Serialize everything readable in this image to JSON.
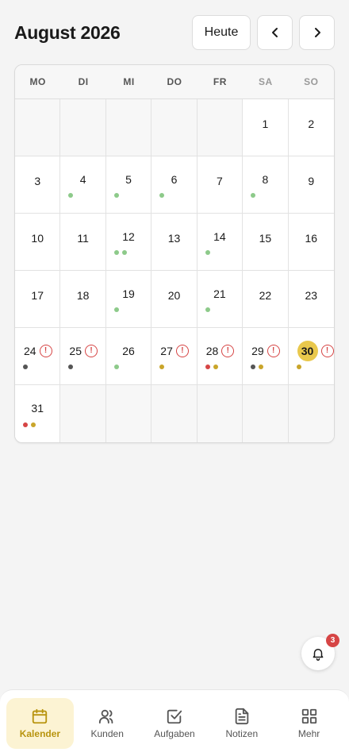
{
  "header": {
    "title": "August 2026",
    "today_label": "Heute",
    "prev_icon": "chevron-left-icon",
    "next_icon": "chevron-right-icon"
  },
  "weekdays": [
    "MO",
    "DI",
    "MI",
    "DO",
    "FR",
    "SA",
    "SO"
  ],
  "colors": {
    "accent": "#e9c84c",
    "green": "#8dca8a",
    "gray": "#555555",
    "gold": "#c9a52a",
    "red": "#d64545"
  },
  "days": [
    {
      "day": null
    },
    {
      "day": null
    },
    {
      "day": null
    },
    {
      "day": null
    },
    {
      "day": null
    },
    {
      "day": "1",
      "dots": []
    },
    {
      "day": "2",
      "dots": []
    },
    {
      "day": "3",
      "dots": []
    },
    {
      "day": "4",
      "dots": [
        "green"
      ]
    },
    {
      "day": "5",
      "dots": [
        "green"
      ]
    },
    {
      "day": "6",
      "dots": [
        "green"
      ]
    },
    {
      "day": "7",
      "dots": []
    },
    {
      "day": "8",
      "dots": [
        "green"
      ]
    },
    {
      "day": "9",
      "dots": []
    },
    {
      "day": "10",
      "dots": []
    },
    {
      "day": "11",
      "dots": []
    },
    {
      "day": "12",
      "dots": [
        "green",
        "green"
      ]
    },
    {
      "day": "13",
      "dots": []
    },
    {
      "day": "14",
      "dots": [
        "green"
      ]
    },
    {
      "day": "15",
      "dots": []
    },
    {
      "day": "16",
      "dots": []
    },
    {
      "day": "17",
      "dots": []
    },
    {
      "day": "18",
      "dots": []
    },
    {
      "day": "19",
      "dots": [
        "green"
      ]
    },
    {
      "day": "20",
      "dots": []
    },
    {
      "day": "21",
      "dots": [
        "green"
      ]
    },
    {
      "day": "22",
      "dots": []
    },
    {
      "day": "23",
      "dots": []
    },
    {
      "day": "24",
      "alert": true,
      "dots": [
        "gray"
      ]
    },
    {
      "day": "25",
      "alert": true,
      "dots": [
        "gray"
      ]
    },
    {
      "day": "26",
      "dots": [
        "green"
      ]
    },
    {
      "day": "27",
      "alert": true,
      "dots": [
        "gold"
      ]
    },
    {
      "day": "28",
      "alert": true,
      "dots": [
        "red",
        "gold"
      ]
    },
    {
      "day": "29",
      "alert": true,
      "dots": [
        "gray",
        "gold"
      ]
    },
    {
      "day": "30",
      "alert": true,
      "today": true,
      "dots": [
        "gold"
      ]
    },
    {
      "day": "31",
      "dots": [
        "red",
        "gold"
      ]
    },
    {
      "day": null
    },
    {
      "day": null
    },
    {
      "day": null
    },
    {
      "day": null
    },
    {
      "day": null
    },
    {
      "day": null
    }
  ],
  "alert_glyph": "!",
  "notifications": {
    "count": "3",
    "icon": "bell-icon"
  },
  "nav": [
    {
      "label": "Kalender",
      "icon": "calendar-icon",
      "active": true
    },
    {
      "label": "Kunden",
      "icon": "users-icon",
      "active": false
    },
    {
      "label": "Aufgaben",
      "icon": "checkbox-icon",
      "active": false
    },
    {
      "label": "Notizen",
      "icon": "document-icon",
      "active": false
    },
    {
      "label": "Mehr",
      "icon": "grid-icon",
      "active": false
    }
  ]
}
